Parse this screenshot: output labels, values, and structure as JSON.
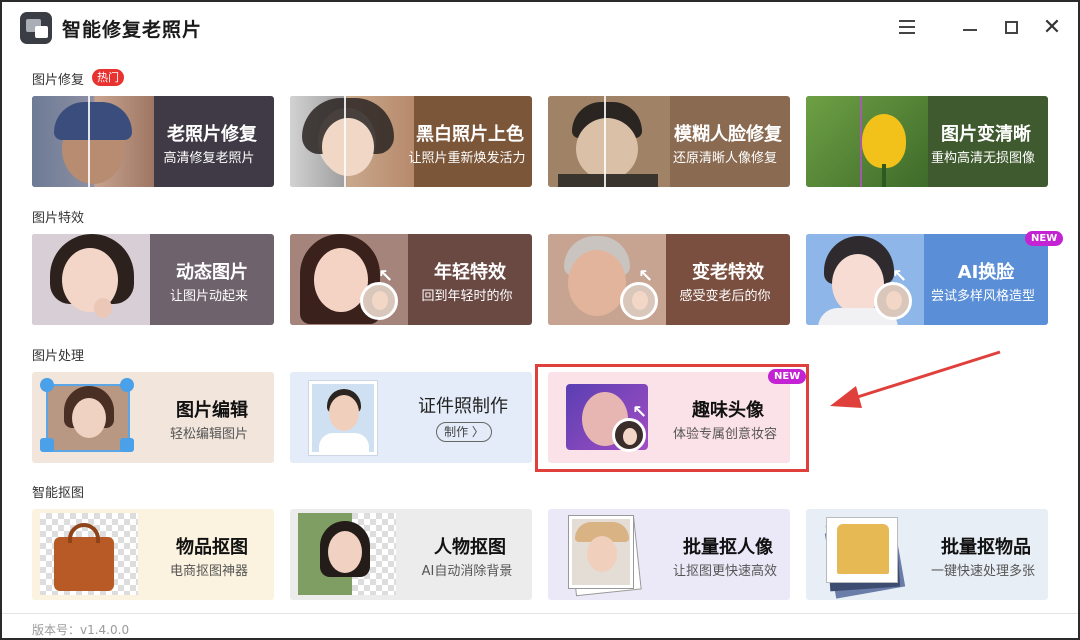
{
  "window": {
    "title": "智能修复老照片"
  },
  "titlebar": {
    "menu_icon": "hamburger-menu-icon",
    "minimize_icon": "minimize-icon",
    "maximize_icon": "maximize-icon",
    "close_icon": "close-icon"
  },
  "sections": {
    "repair": {
      "label": "图片修复",
      "badge": "热门",
      "cards": [
        {
          "title": "老照片修复",
          "subtitle": "高清修复老照片"
        },
        {
          "title": "黑白照片上色",
          "subtitle": "让照片重新焕发活力"
        },
        {
          "title": "模糊人脸修复",
          "subtitle": "还原清晰人像修复"
        },
        {
          "title": "图片变清晰",
          "subtitle": "重构高清无损图像"
        }
      ]
    },
    "effects": {
      "label": "图片特效",
      "cards": [
        {
          "title": "动态图片",
          "subtitle": "让图片动起来"
        },
        {
          "title": "年轻特效",
          "subtitle": "回到年轻时的你"
        },
        {
          "title": "变老特效",
          "subtitle": "感受变老后的你"
        },
        {
          "title": "AI换脸",
          "subtitle": "尝试多样风格造型",
          "badge": "NEW"
        }
      ]
    },
    "processing": {
      "label": "图片处理",
      "cards": [
        {
          "title": "图片编辑",
          "subtitle": "轻松编辑图片"
        },
        {
          "title": "证件照制作",
          "button": "制作 〉"
        },
        {
          "title": "趣味头像",
          "subtitle": "体验专属创意妆容",
          "badge": "NEW"
        }
      ]
    },
    "cutout": {
      "label": "智能抠图",
      "cards": [
        {
          "title": "物品抠图",
          "subtitle": "电商抠图神器"
        },
        {
          "title": "人物抠图",
          "subtitle": "AI自动消除背景"
        },
        {
          "title": "批量抠人像",
          "subtitle": "让抠图更快速高效"
        },
        {
          "title": "批量抠物品",
          "subtitle": "一键快速处理多张"
        }
      ]
    }
  },
  "footer": {
    "version": "版本号：v1.4.0.0"
  },
  "colors": {
    "hot_badge": "#e8322f",
    "new_badge": "#c323d2",
    "highlight_border": "#e0403b"
  }
}
